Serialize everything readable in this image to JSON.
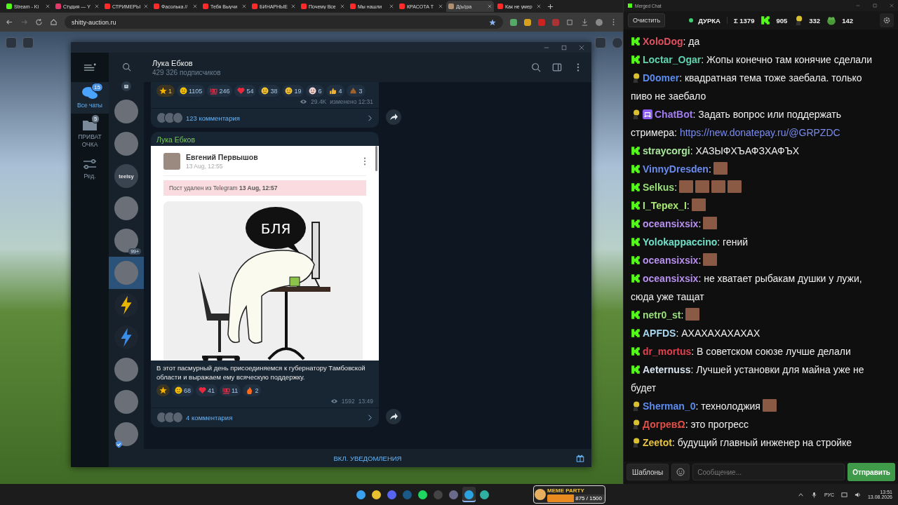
{
  "browser": {
    "tabs": [
      {
        "title": "Stream - Ki",
        "kind": "kick",
        "selected": false
      },
      {
        "title": "Студия — Y",
        "kind": "studio",
        "selected": false
      },
      {
        "title": "СТРИМЕРЫ",
        "kind": "youtube",
        "selected": false
      },
      {
        "title": "Фасолька //",
        "kind": "youtube",
        "selected": false
      },
      {
        "title": "Тебя Выучи",
        "kind": "youtube",
        "selected": false
      },
      {
        "title": "БИНАРНЫЕ",
        "kind": "youtube",
        "selected": false
      },
      {
        "title": "Почему Все",
        "kind": "youtube",
        "selected": false
      },
      {
        "title": "Мы нашли",
        "kind": "youtube",
        "selected": false
      },
      {
        "title": "КРАСОТА Т",
        "kind": "youtube",
        "selected": false
      },
      {
        "title": "Д(ы)ра",
        "kind": "avatar",
        "selected": true
      },
      {
        "title": "Как не умер",
        "kind": "youtube",
        "selected": false
      }
    ],
    "url": "shitty-auction.ru"
  },
  "telegram": {
    "folders": [
      {
        "label": "Все чаты",
        "badge": "15",
        "kind": "chats",
        "selected": true
      },
      {
        "label": "ПРИВАТ ОЧКА",
        "badge": "5",
        "kind": "folder",
        "selected": false
      },
      {
        "label": "Ред.",
        "kind": "edit",
        "selected": false
      }
    ],
    "chats": [
      {
        "kind": "archive",
        "selected": false
      },
      {
        "kind": "photo",
        "selected": false
      },
      {
        "kind": "photo",
        "selected": false
      },
      {
        "kind": "text",
        "text": "teelsy",
        "selected": false
      },
      {
        "kind": "photo",
        "selected": false
      },
      {
        "kind": "photo",
        "badge": "99+",
        "selected": false
      },
      {
        "kind": "photo",
        "selected": true
      },
      {
        "kind": "lightning",
        "color": "#e8b400",
        "selected": false
      },
      {
        "kind": "lightning",
        "color": "#3a8ee8",
        "selected": false
      },
      {
        "kind": "photo",
        "selected": false
      },
      {
        "kind": "photo",
        "selected": false
      },
      {
        "kind": "photo",
        "verified": true,
        "selected": false
      }
    ],
    "channel": {
      "name": "Лука Ебков",
      "subscribers": "429 326 подписчиков"
    },
    "posts": [
      {
        "reactions": [
          {
            "kind": "star",
            "count": "1"
          },
          {
            "kind": "laugh",
            "count": "1105"
          },
          {
            "kind": "hundred",
            "count": "246"
          },
          {
            "kind": "heart",
            "count": "54"
          },
          {
            "kind": "cry",
            "count": "38"
          },
          {
            "kind": "sob",
            "count": "19"
          },
          {
            "kind": "clown",
            "count": "6"
          },
          {
            "kind": "thumbs",
            "count": "4"
          },
          {
            "kind": "poop",
            "count": "3"
          }
        ],
        "views": "29.4K",
        "time": "изменено 12:31",
        "comments": "123 комментария"
      },
      {
        "author": "Лука Ебков",
        "card": {
          "name": "Евгений Первышов",
          "date": "13 Aug, 12:55",
          "notice": "Пост удален из Telegram **13 Aug, 12:57**",
          "bubble": "БЛЯ"
        },
        "caption": "В этот пасмурный день присоединяемся к губернатору Тамбовской области и выражаем ему всяческую поддержку.",
        "reactions": [
          {
            "kind": "star"
          },
          {
            "kind": "laugh",
            "count": "68"
          },
          {
            "kind": "heart",
            "count": "41"
          },
          {
            "kind": "hundred",
            "count": "11"
          },
          {
            "kind": "fire",
            "count": "2"
          }
        ],
        "views": "1592",
        "time": "13:49",
        "comments": "4 комментария"
      }
    ],
    "footer": "ВКЛ. УВЕДОМЛЕНИЯ"
  },
  "chat": {
    "window_title": "Merged Chat",
    "clear": "Очистить",
    "channel": "ДУРКА",
    "stats": [
      {
        "kind": "total",
        "value": "Σ 1379"
      },
      {
        "kind": "kick",
        "value": "905"
      },
      {
        "kind": "other",
        "value": "332"
      },
      {
        "kind": "frog",
        "value": "142"
      }
    ],
    "messages": [
      {
        "kind": "kick",
        "user": "XoloDog",
        "color": "#e0505e",
        "parts": [
          {
            "kind": "text",
            "text": ": да"
          }
        ]
      },
      {
        "kind": "kick",
        "user": "Loctar_Ogar",
        "color": "#5fd3b0",
        "parts": [
          {
            "kind": "text",
            "text": ": Жопы конечно там конячие сделали"
          }
        ]
      },
      {
        "kind": "other",
        "user": "D0omer",
        "color": "#5b8cf0",
        "parts": [
          {
            "kind": "text",
            "text": ": квадратная тема тоже заебала. только"
          },
          {
            "kind": "wrap",
            "text": "пиво не заебало"
          }
        ]
      },
      {
        "kind": "other",
        "bot": true,
        "user": "ChatBot",
        "color": "#a07cf0",
        "parts": [
          {
            "kind": "text",
            "text": ": Задать вопрос или поддержать"
          },
          {
            "kind": "wrap",
            "text": "стримера:"
          },
          {
            "kind": "link",
            "text": "https://new.donatepay.ru/@GRPZDC"
          }
        ]
      },
      {
        "kind": "kick",
        "user": "straycorgi",
        "color": "#a8e89a",
        "parts": [
          {
            "kind": "text",
            "text": ": ХАЗЫФХЪАФЗХАФЪХ"
          }
        ]
      },
      {
        "kind": "kick",
        "user": "VinnyDresden",
        "color": "#6a8cf0",
        "parts": [
          {
            "kind": "text",
            "text": ":"
          },
          {
            "kind": "emote"
          }
        ]
      },
      {
        "kind": "kick",
        "user": "Selkus",
        "color": "#9ae07a",
        "parts": [
          {
            "kind": "text",
            "text": ":"
          },
          {
            "kind": "emote"
          },
          {
            "kind": "emote"
          },
          {
            "kind": "emote"
          },
          {
            "kind": "emote"
          }
        ]
      },
      {
        "kind": "kick",
        "user": "I_Tepex_I",
        "color": "#a8e870",
        "parts": [
          {
            "kind": "text",
            "text": ":"
          },
          {
            "kind": "emote"
          }
        ]
      },
      {
        "kind": "kick",
        "user": "oceansixsix",
        "color": "#b890f0",
        "parts": [
          {
            "kind": "text",
            "text": ":"
          },
          {
            "kind": "emote"
          }
        ]
      },
      {
        "kind": "kick",
        "user": "Yolokappaccino",
        "color": "#70e0c8",
        "parts": [
          {
            "kind": "text",
            "text": ": гений"
          }
        ]
      },
      {
        "kind": "kick",
        "user": "oceansixsix",
        "color": "#b890f0",
        "parts": [
          {
            "kind": "text",
            "text": ":"
          },
          {
            "kind": "emote"
          }
        ]
      },
      {
        "kind": "kick",
        "user": "oceansixsix",
        "color": "#b890f0",
        "parts": [
          {
            "kind": "text",
            "text": ": не хватает рыбакам душки у лужи,"
          },
          {
            "kind": "wrap",
            "text": "сюда уже тащат"
          }
        ]
      },
      {
        "kind": "kick",
        "user": "netr0_st",
        "color": "#9ae07a",
        "parts": [
          {
            "kind": "text",
            "text": ":"
          },
          {
            "kind": "emote"
          }
        ]
      },
      {
        "kind": "kick",
        "user": "APFDS",
        "color": "#a8d8f0",
        "parts": [
          {
            "kind": "text",
            "text": ": АХАХАХАХАХАХ"
          }
        ]
      },
      {
        "kind": "kick",
        "user": "dr_mortus",
        "color": "#e0404e",
        "parts": [
          {
            "kind": "text",
            "text": ": В советском союзе лучше делали"
          }
        ]
      },
      {
        "kind": "kick",
        "user": "Aeternuss",
        "color": "#d8e4f0",
        "parts": [
          {
            "kind": "text",
            "text": ": Лучшей установки для майна уже не"
          },
          {
            "kind": "wrap",
            "text": "будет"
          }
        ]
      },
      {
        "kind": "other",
        "user": "Sherman_0",
        "color": "#5b8cf0",
        "parts": [
          {
            "kind": "text",
            "text": ": технолоджия"
          },
          {
            "kind": "emote"
          }
        ]
      },
      {
        "kind": "other",
        "user": "ДогревΩ",
        "color": "#e05048",
        "parts": [
          {
            "kind": "text",
            "text": ": это прогресс"
          }
        ]
      },
      {
        "kind": "other",
        "user": "Zeetot",
        "color": "#e8c440",
        "parts": [
          {
            "kind": "text",
            "text": ": будущий  главный инженер на стройке"
          }
        ]
      }
    ],
    "templates": "Шаблоны",
    "placeholder": "Сообщение...",
    "send": "Отправить"
  },
  "taskbar": {
    "apps": [
      {
        "kind": "windows",
        "selected": false
      },
      {
        "kind": "chrome",
        "selected": false
      },
      {
        "kind": "discord",
        "selected": false
      },
      {
        "kind": "steam",
        "selected": false
      },
      {
        "kind": "spotify",
        "selected": false
      },
      {
        "kind": "obs",
        "selected": false
      },
      {
        "kind": "disc",
        "selected": false
      },
      {
        "kind": "telegram",
        "selected": true
      },
      {
        "kind": "capture",
        "selected": false
      }
    ],
    "widget": {
      "title": "MEME PARTY",
      "progress": "875 / 1500",
      "level": 0.58
    },
    "language": "РУС",
    "time": "13:51",
    "date": "13.08.2026"
  }
}
